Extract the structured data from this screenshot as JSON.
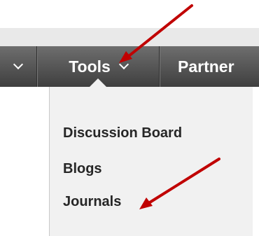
{
  "navbar": {
    "items": [
      {
        "label": "",
        "icon": "chevron-down-icon"
      },
      {
        "label": "Tools",
        "icon": "chevron-down-icon"
      },
      {
        "label": "Partner",
        "icon": ""
      }
    ]
  },
  "dropdown": {
    "items": [
      "Discussion Board",
      "Blogs",
      "Journals"
    ]
  },
  "annotations": {
    "arrow_color": "#c00000",
    "arrows": [
      "arrow-to-tools",
      "arrow-to-journals"
    ]
  },
  "colors": {
    "navbar_top": "#6e6e6e",
    "navbar_bottom": "#3f3f3f",
    "dropdown_bg": "#f1f1f1",
    "menu_text": "#262626"
  }
}
